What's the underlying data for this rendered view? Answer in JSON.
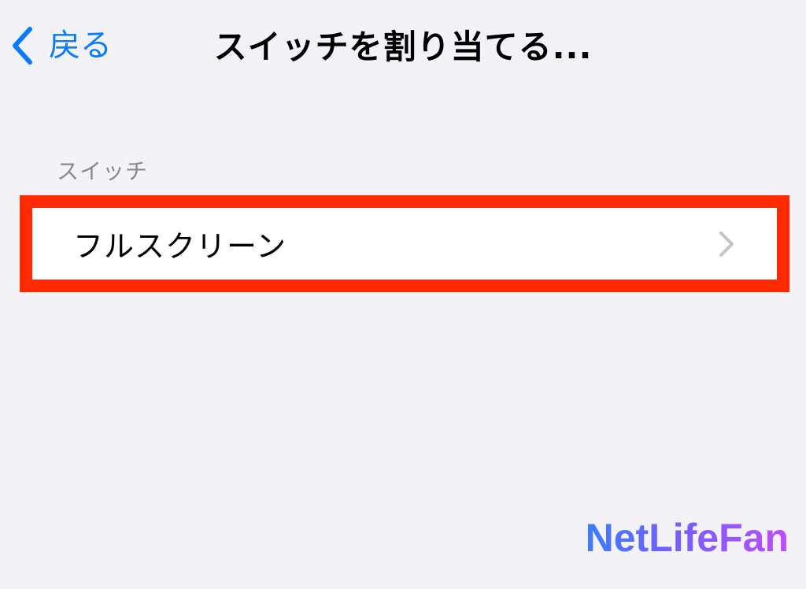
{
  "nav": {
    "back_label": "戻る",
    "title": "スイッチを割り当てる..."
  },
  "section": {
    "header": "スイッチ",
    "items": [
      {
        "label": "フルスクリーン",
        "icon": "chevron-right-icon"
      }
    ]
  },
  "highlight_color": "#ff2a00",
  "accent_color": "#0a7aff",
  "watermark": "NetLifeFan"
}
